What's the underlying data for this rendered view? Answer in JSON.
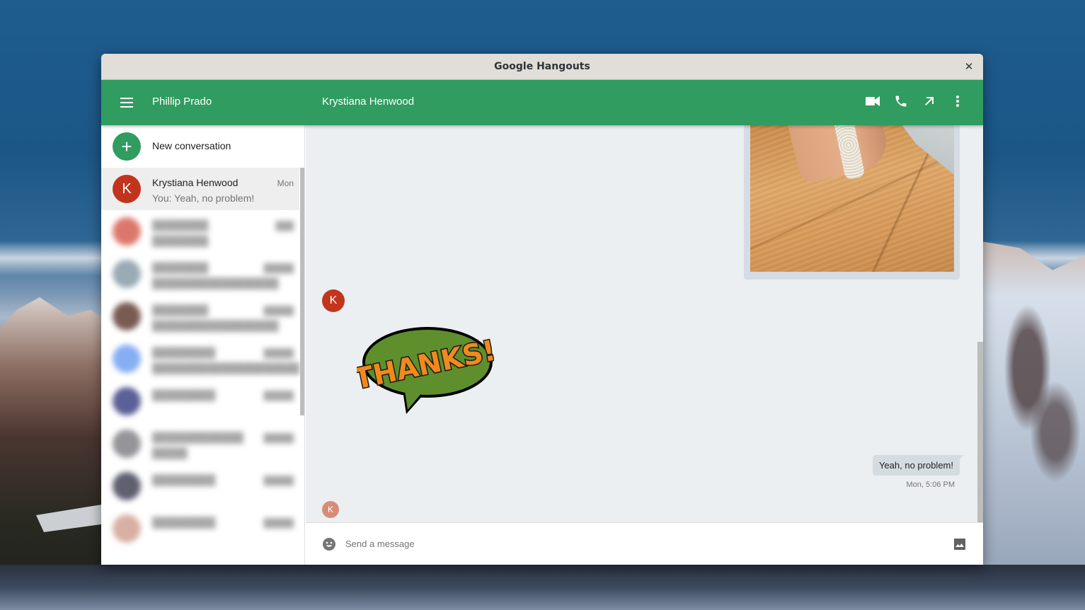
{
  "window": {
    "title": "Google Hangouts",
    "close_icon": "close-icon"
  },
  "appbar": {
    "menu_icon": "hamburger-menu-icon",
    "user_name": "Phillip Prado",
    "contact_name": "Krystiana Henwood",
    "actions": [
      {
        "name": "video-call",
        "icon": "video-camera-icon"
      },
      {
        "name": "voice-call",
        "icon": "phone-icon"
      },
      {
        "name": "pop-out",
        "icon": "arrow-up-right-icon"
      },
      {
        "name": "more-options",
        "icon": "more-vert-icon"
      }
    ],
    "brand_color": "#309c5f"
  },
  "sidebar": {
    "new_conversation": {
      "label": "New conversation",
      "icon": "plus-icon"
    },
    "conversations": [
      {
        "initial": "K",
        "name": "Krystiana Henwood",
        "time": "Mon",
        "preview": "You: Yeah, no problem!",
        "avatar_color": "#c1351d",
        "active": true,
        "blurred": false
      },
      {
        "initial": "",
        "name": "████████",
        "time": "███",
        "preview": "████████",
        "avatar_color": "#d96a5c",
        "active": false,
        "blurred": true
      },
      {
        "initial": "",
        "name": "████████",
        "time": "█████",
        "preview": "██████████████████",
        "avatar_color": "#8ea2ae",
        "active": false,
        "blurred": true
      },
      {
        "initial": "",
        "name": "████████",
        "time": "█████",
        "preview": "██████████████████",
        "avatar_color": "#6b4a40",
        "active": false,
        "blurred": true
      },
      {
        "initial": "",
        "name": "█████████",
        "time": "█████",
        "preview": "█████████████████████",
        "avatar_color": "#7aa6f2",
        "active": false,
        "blurred": true
      },
      {
        "initial": "",
        "name": "█████████",
        "time": "█████",
        "preview": "",
        "avatar_color": "#4a4f8c",
        "active": false,
        "blurred": true
      },
      {
        "initial": "",
        "name": "█████████████",
        "time": "█████",
        "preview": "█████",
        "avatar_color": "#8a8a8e",
        "active": false,
        "blurred": true
      },
      {
        "initial": "",
        "name": "█████████",
        "time": "█████",
        "preview": "",
        "avatar_color": "#4e5062",
        "active": false,
        "blurred": true
      },
      {
        "initial": "",
        "name": "█████████",
        "time": "█████",
        "preview": "",
        "avatar_color": "#d4a79a",
        "active": false,
        "blurred": true
      }
    ]
  },
  "chat": {
    "contact_initial": "K",
    "sticker_text": "THANKS!",
    "outgoing_message": "Yeah, no problem!",
    "outgoing_time": "Mon, 5:06 PM",
    "read_receipt_initial": "K"
  },
  "composer": {
    "placeholder": "Send a message",
    "value": "",
    "emoji_icon": "emoji-smile-icon",
    "image_icon": "image-icon"
  }
}
